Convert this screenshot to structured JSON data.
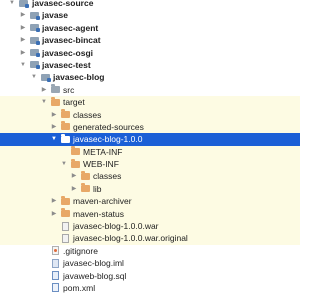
{
  "tree": {
    "items": [
      {
        "label": "javasec-source",
        "icon": "module-icon",
        "expanded": true
      },
      {
        "label": "javase",
        "icon": "module-icon",
        "expanded": false
      },
      {
        "label": "javasec-agent",
        "icon": "module-icon",
        "expanded": false
      },
      {
        "label": "javasec-bincat",
        "icon": "module-icon",
        "expanded": false
      },
      {
        "label": "javasec-osgi",
        "icon": "module-icon",
        "expanded": false
      },
      {
        "label": "javasec-test",
        "icon": "module-icon",
        "expanded": true
      },
      {
        "label": "javasec-blog",
        "icon": "module-icon",
        "expanded": true
      },
      {
        "label": "src",
        "icon": "folder-icon",
        "expanded": false
      },
      {
        "label": "target",
        "icon": "folder-icon",
        "expanded": true
      },
      {
        "label": "classes",
        "icon": "folder-icon",
        "expanded": false
      },
      {
        "label": "generated-sources",
        "icon": "folder-icon",
        "expanded": false
      },
      {
        "label": "javasec-blog-1.0.0",
        "icon": "folder-icon",
        "expanded": true,
        "selected": true
      },
      {
        "label": "META-INF",
        "icon": "folder-icon"
      },
      {
        "label": "WEB-INF",
        "icon": "folder-icon",
        "expanded": true
      },
      {
        "label": "classes",
        "icon": "folder-icon",
        "expanded": false
      },
      {
        "label": "lib",
        "icon": "folder-icon",
        "expanded": false
      },
      {
        "label": "maven-archiver",
        "icon": "folder-icon",
        "expanded": false
      },
      {
        "label": "maven-status",
        "icon": "folder-icon",
        "expanded": false
      },
      {
        "label": "javasec-blog-1.0.0.war",
        "icon": "archive-file-icon"
      },
      {
        "label": "javasec-blog-1.0.0.war.original",
        "icon": "file-icon"
      },
      {
        "label": ".gitignore",
        "icon": "gitignore-file-icon"
      },
      {
        "label": "javasec-blog.iml",
        "icon": "iml-file-icon"
      },
      {
        "label": "javaweb-blog.sql",
        "icon": "sql-file-icon"
      },
      {
        "label": "pom.xml",
        "icon": "xml-file-icon"
      }
    ]
  },
  "colors": {
    "selection": "#1b5fd6",
    "target_highlight": "#fdfbe3",
    "excluded_folder": "#e8a867",
    "module_folder": "#8fa2b5"
  }
}
